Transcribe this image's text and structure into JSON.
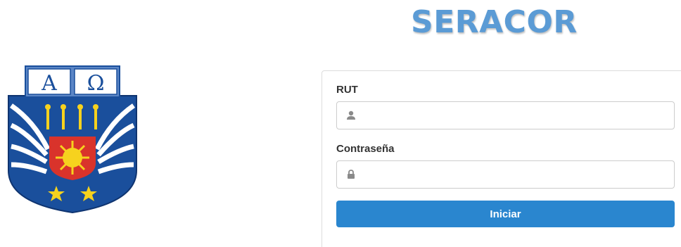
{
  "header": {
    "title": "SERACOR"
  },
  "logo": {
    "name": "university-crest",
    "letters_left": "A",
    "letters_right": "Ω"
  },
  "login": {
    "rut_label": "RUT",
    "rut_value": "",
    "rut_placeholder": "",
    "rut_icon": "user-icon",
    "password_label": "Contraseña",
    "password_value": "",
    "password_placeholder": "",
    "password_icon": "lock-icon",
    "submit_label": "Iniciar"
  },
  "colors": {
    "title": "#5b9bd5",
    "button": "#2a86cf",
    "crest_blue": "#1a4f9c",
    "crest_red": "#d9332b",
    "crest_yellow": "#f6d21e"
  }
}
